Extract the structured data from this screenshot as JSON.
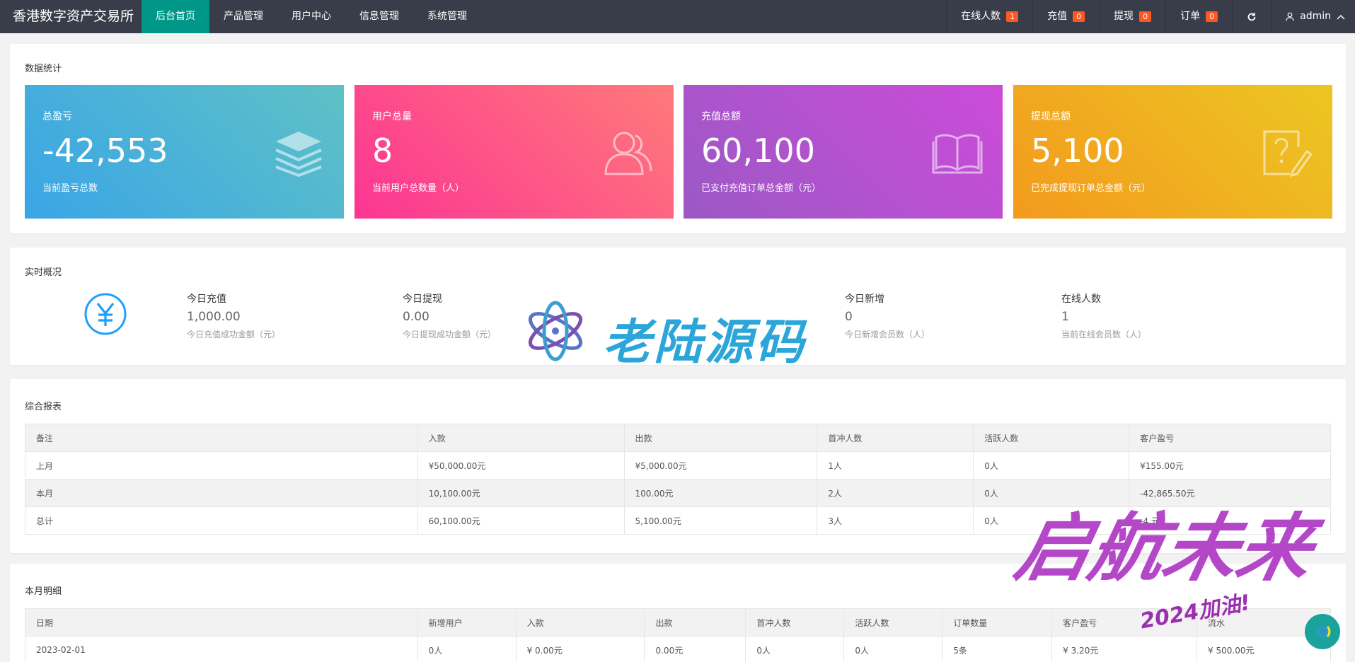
{
  "app": {
    "title": "香港数字资产交易所"
  },
  "nav": [
    {
      "label": "后台首页",
      "active": true
    },
    {
      "label": "产品管理"
    },
    {
      "label": "用户中心"
    },
    {
      "label": "信息管理"
    },
    {
      "label": "系统管理"
    }
  ],
  "right_nav": {
    "online": {
      "label": "在线人数",
      "count": "1"
    },
    "recharge": {
      "label": "充值",
      "count": "0"
    },
    "withdraw": {
      "label": "提现",
      "count": "0"
    },
    "orders": {
      "label": "订单",
      "count": "0"
    },
    "refresh_icon": "refresh-icon",
    "user": "admin"
  },
  "stats": {
    "title": "数据统计",
    "cards": [
      {
        "label": "总盈亏",
        "value": "-42,553",
        "sub": "当前盈亏总数",
        "icon": "layers-icon",
        "colors": [
          "#3aa5e6",
          "#5ec1c6"
        ]
      },
      {
        "label": "用户总量",
        "value": "8",
        "sub": "当前用户总数量（人）",
        "icon": "users-icon",
        "colors": [
          "#fc3593",
          "#ff7a7a"
        ]
      },
      {
        "label": "充值总额",
        "value": "60,100",
        "sub": "已支付充值订单总金额（元）",
        "icon": "book-icon",
        "colors": [
          "#9b59c5",
          "#cc4bd9"
        ]
      },
      {
        "label": "提现总额",
        "value": "5,100",
        "sub": "已完成提现订单总金额（元）",
        "icon": "question-edit-icon",
        "colors": [
          "#f39a1e",
          "#ecc622"
        ]
      }
    ]
  },
  "realtime": {
    "title": "实时概况",
    "icon": "yen-icon",
    "items": [
      {
        "label": "今日充值",
        "value": "1,000.00",
        "sub": "今日充值成功金额（元）"
      },
      {
        "label": "今日提现",
        "value": "0.00",
        "sub": "今日提现成功金额（元）"
      },
      {
        "label": "今日新增",
        "value": "0",
        "sub": "今日新增会员数（人）"
      },
      {
        "label": "在线人数",
        "value": "1",
        "sub": "当前在线会员数（人）"
      }
    ]
  },
  "report": {
    "title": "综合报表",
    "columns": [
      "备注",
      "入款",
      "出款",
      "首冲人数",
      "活跃人数",
      "客户盈亏"
    ],
    "rows": [
      [
        "上月",
        "¥50,000.00元",
        "¥5,000.00元",
        "1人",
        "0人",
        "¥155.00元"
      ],
      [
        "本月",
        "10,100.00元",
        "100.00元",
        "2人",
        "0人",
        "-42,865.50元"
      ],
      [
        "总计",
        "60,100.00元",
        "5,100.00元",
        "3人",
        "0人",
        "-4       元"
      ]
    ]
  },
  "monthly": {
    "title": "本月明细",
    "columns": [
      "日期",
      "新增用户",
      "入款",
      "出款",
      "首冲人数",
      "活跃人数",
      "订单数量",
      "客户盈亏",
      "流水"
    ],
    "rows": [
      [
        "2023-02-01",
        "0人",
        "¥ 0.00元",
        "0.00元",
        "0人",
        "0人",
        "5条",
        "¥ 3.20元",
        "¥ 500.00元"
      ]
    ]
  },
  "watermarks": {
    "center": "老陆源码",
    "corner": "启航未来",
    "corner_sub": "2024加油!"
  },
  "float_button_icon": "chat-icon"
}
